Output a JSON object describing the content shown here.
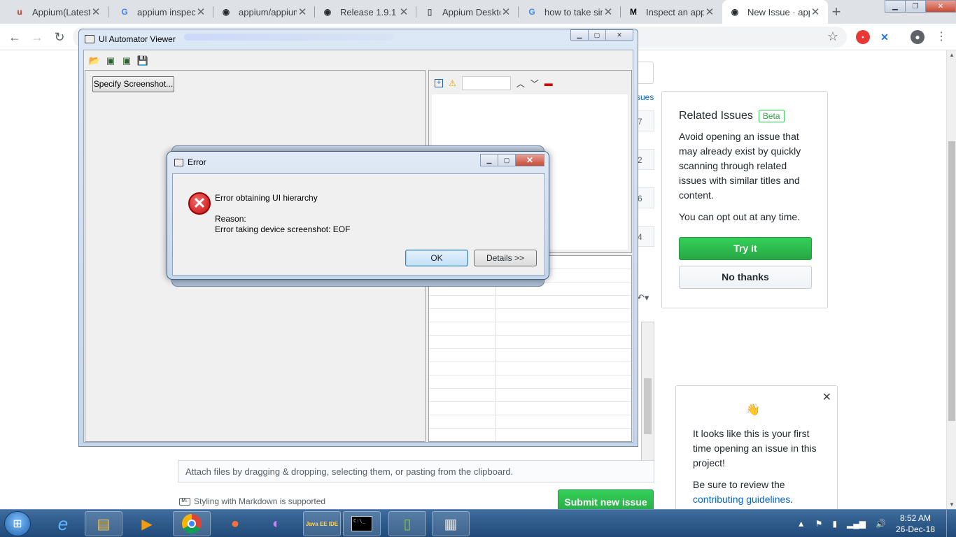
{
  "browser": {
    "tabs": [
      {
        "title": "Appium(Latest",
        "icon": "appium-icon",
        "glyph": "u",
        "color": "#c0392b",
        "active": false
      },
      {
        "title": "appium inspect",
        "icon": "google-icon",
        "glyph": "G",
        "color": "#4285f4",
        "active": false
      },
      {
        "title": "appium/appium",
        "icon": "github-icon",
        "glyph": "◉",
        "color": "#24292e",
        "active": false
      },
      {
        "title": "Release 1.9.1 · a",
        "icon": "github-icon",
        "glyph": "◉",
        "color": "#24292e",
        "active": false
      },
      {
        "title": "Appium Deskto",
        "icon": "document-icon",
        "glyph": "▯",
        "color": "#5f6368",
        "active": false
      },
      {
        "title": "how to take sim",
        "icon": "google-icon",
        "glyph": "G",
        "color": "#4285f4",
        "active": false
      },
      {
        "title": "Inspect an app",
        "icon": "medium-icon",
        "glyph": "M",
        "color": "#000000",
        "active": false
      },
      {
        "title": "New Issue · app",
        "icon": "github-icon",
        "glyph": "◉",
        "color": "#24292e",
        "active": true
      }
    ],
    "tab_close_glyph": "✕",
    "new_tab_glyph": "+"
  },
  "uiav": {
    "title": "UI Automator Viewer",
    "specify_label": "Specify Screenshot..."
  },
  "error": {
    "title": "Error",
    "heading": "Error obtaining UI hierarchy",
    "reason_label": "Reason:",
    "reason_text": "Error taking device screenshot: EOF",
    "ok_label": "OK",
    "details_label": "Details >>"
  },
  "github": {
    "related_title": "Related Issues",
    "beta": "Beta",
    "related_text": "Avoid opening an issue that may already exist by quickly scanning through related issues with similar titles and content.",
    "opt_out": "You can opt out at any time.",
    "try_it": "Try it",
    "no_thanks": "No thanks",
    "edge_labels": [
      "sues",
      "7",
      "2",
      "6",
      "4"
    ],
    "first_time_text": "It looks like this is your first time opening an issue in this project!",
    "review_text": "Be sure to review the",
    "guidelines_link": "contributing guidelines",
    "guidelines_suffix": ".",
    "attach_text": "Attach files by dragging & dropping, selecting them, or pasting from the clipboard.",
    "markdown_text": "Styling with Markdown is supported",
    "markdown_icon": "M↓",
    "submit": "Submit new issue"
  },
  "taskbar": {
    "time": "8:52 AM",
    "date": "26-Dec-18",
    "java_label": "Java EE IDE",
    "cmd_label": "C:\\_"
  },
  "colors": {
    "github_green": "#28a745",
    "link_blue": "#0366d6",
    "error_red": "#c40f0f",
    "taskbar_blue": "#1f4a7a"
  }
}
